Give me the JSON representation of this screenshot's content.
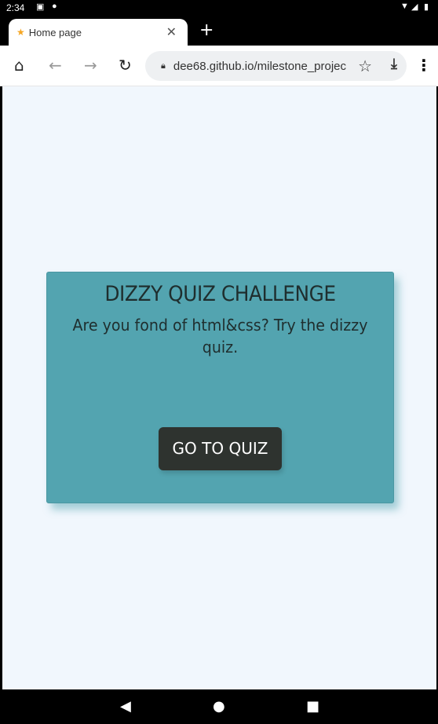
{
  "status_bar": {
    "time": "2:34",
    "icons": [
      "notification-a-icon",
      "app-icon",
      "wifi-icon",
      "signal-icon",
      "battery-icon"
    ]
  },
  "browser": {
    "tab": {
      "title": "Home page",
      "favicon": "star-favicon-icon"
    },
    "url": "dee68.github.io/milestone_projec"
  },
  "page": {
    "background": "#f1f7fd",
    "card": {
      "color": "#53a4b0",
      "title": "DIZZY QUIZ CHALLENGE",
      "text": "Are you fond of html&css? Try the dizzy quiz.",
      "button_label": "GO TO QUIZ",
      "button_color": "#2e332f"
    }
  }
}
